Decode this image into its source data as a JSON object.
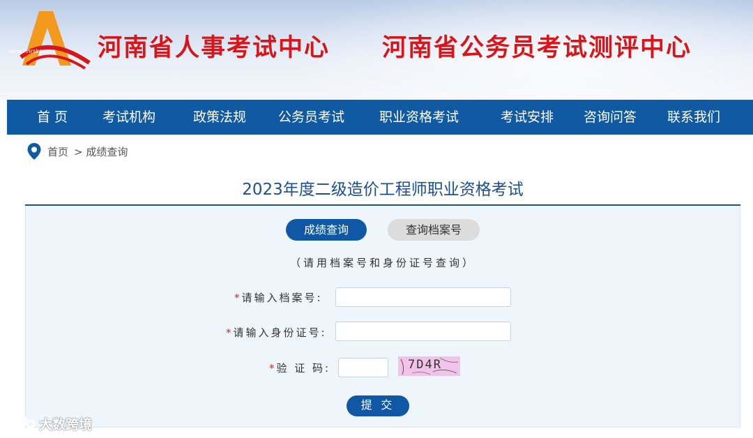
{
  "header": {
    "logo_text": "www.hnrsks.com",
    "title_1": "河南省人事考试中心",
    "title_2": "河南省公务员考试测评中心"
  },
  "nav": {
    "items": [
      {
        "label": "首 页"
      },
      {
        "label": "考试机构"
      },
      {
        "label": "政策法规"
      },
      {
        "label": "公务员考试"
      },
      {
        "label": "职业资格考试"
      },
      {
        "label": "考试安排"
      },
      {
        "label": "咨询问答"
      },
      {
        "label": "联系我们"
      }
    ]
  },
  "breadcrumb": {
    "home": "首页",
    "current": "> 成绩查询"
  },
  "page": {
    "title": "2023年度二级造价工程师职业资格考试"
  },
  "tabs": {
    "active": "成绩查询",
    "inactive": "查询档案号"
  },
  "form": {
    "hint": "（请用档案号和身份证号查询）",
    "required_mark": "*",
    "archive_label": "请输入档案号:",
    "archive_value": "",
    "id_label": "请输入身份证号:",
    "id_value": "",
    "captcha_label": "验 证 码:",
    "captcha_value": "",
    "captcha_image_text": "7D4R",
    "submit_label": "提 交"
  },
  "watermark": {
    "text": "大数跨境"
  },
  "colors": {
    "brand_blue": "#0f5aa3",
    "title_red": "#d7161c",
    "required_red": "#e02020",
    "panel_bg": "#eef6fb"
  }
}
